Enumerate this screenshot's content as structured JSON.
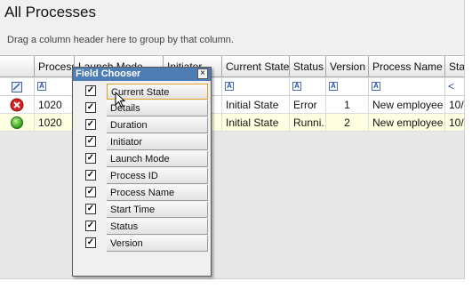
{
  "title": "All Processes",
  "group_hint": "Drag a column header here to group by that column.",
  "columns": [
    {
      "label": ""
    },
    {
      "label": "Process ID"
    },
    {
      "label": "Launch Mode"
    },
    {
      "label": "Initiator"
    },
    {
      "label": "Current State"
    },
    {
      "label": "Status"
    },
    {
      "label": "Version"
    },
    {
      "label": "Process Name"
    },
    {
      "label": "Start Time"
    }
  ],
  "filter_row": {
    "last_symbol": "<"
  },
  "rows": [
    {
      "status_icon": "error-icon",
      "process_id": "1020",
      "current_state": "Initial State",
      "status": "Error",
      "version": "1",
      "process_name": "New employee",
      "start_time": "10/"
    },
    {
      "status_icon": "running-icon",
      "process_id": "1020",
      "current_state": "Initial State",
      "status": "Runni...",
      "version": "2",
      "process_name": "New employee",
      "start_time": "10/"
    }
  ],
  "field_chooser": {
    "title": "Field Chooser",
    "close_label": "×",
    "fields": [
      {
        "label": "Current State",
        "checked": true
      },
      {
        "label": "Details",
        "checked": true
      },
      {
        "label": "Duration",
        "checked": true
      },
      {
        "label": "Initiator",
        "checked": true
      },
      {
        "label": "Launch Mode",
        "checked": true
      },
      {
        "label": "Process ID",
        "checked": true
      },
      {
        "label": "Process Name",
        "checked": true
      },
      {
        "label": "Start Time",
        "checked": true
      },
      {
        "label": "Status",
        "checked": true
      },
      {
        "label": "Version",
        "checked": true
      }
    ]
  }
}
